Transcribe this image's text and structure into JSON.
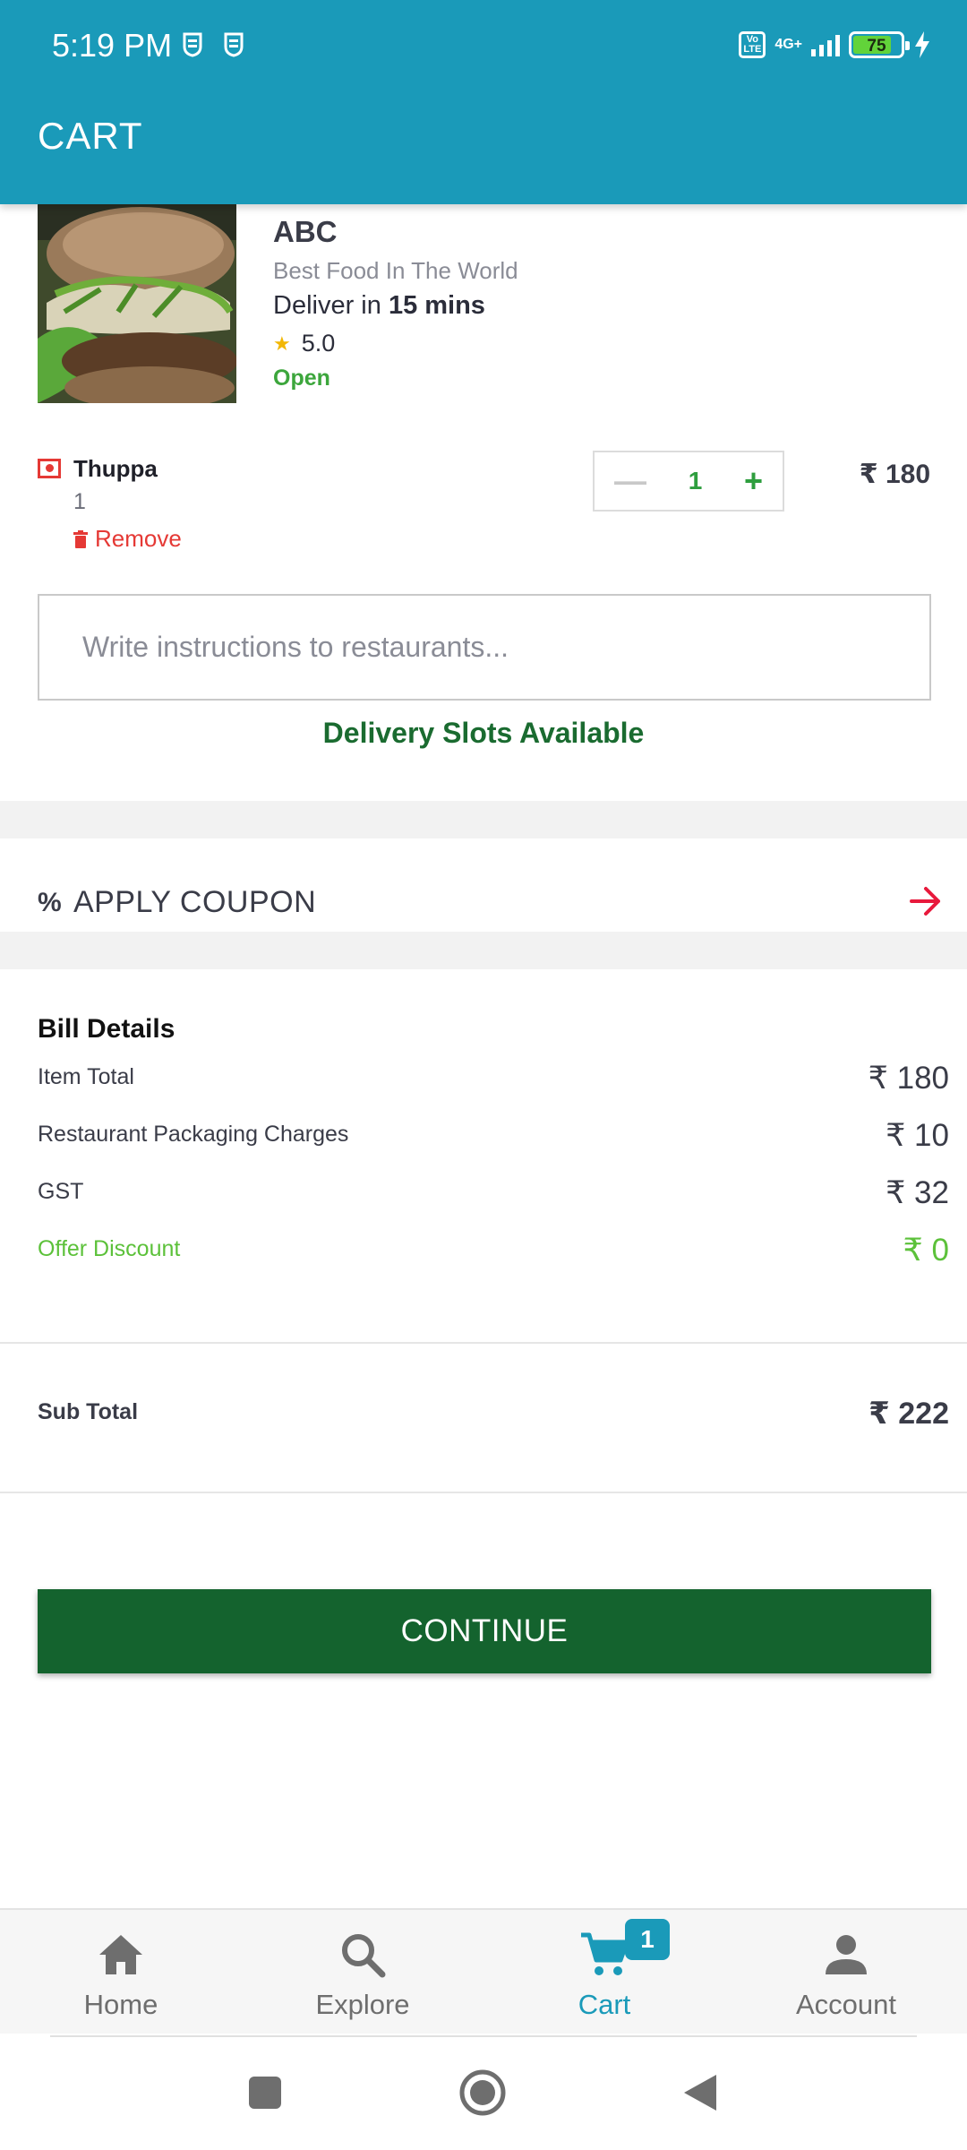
{
  "status_bar": {
    "time": "5:19 PM",
    "volte": "Vo LTE",
    "network": "4G+",
    "battery": "75"
  },
  "app_bar": {
    "title": "CART"
  },
  "restaurant": {
    "name": "ABC",
    "tagline": "Best Food In The World",
    "deliver_prefix": "Deliver in ",
    "deliver_time": "15 mins",
    "rating": "5.0",
    "status": "Open",
    "image": "burger-photo"
  },
  "cart_item": {
    "name": "Thuppa",
    "quantity_text": "1",
    "remove_label": "Remove",
    "quantity": "1",
    "price": "₹ 180"
  },
  "instructions": {
    "placeholder": "Write instructions to restaurants..."
  },
  "delivery_slots": "Delivery Slots Available",
  "coupon": {
    "icon": "%",
    "label": "APPLY COUPON"
  },
  "bill": {
    "title": "Bill Details",
    "rows": [
      {
        "label": "Item Total",
        "value": "₹ 180"
      },
      {
        "label": "Restaurant Packaging Charges",
        "value": "₹ 10"
      },
      {
        "label": "GST",
        "value": "₹ 32"
      },
      {
        "label": "Offer Discount",
        "value": "₹ 0"
      }
    ],
    "subtotal_label": "Sub Total",
    "subtotal_value": "₹ 222"
  },
  "continue_label": "CONTINUE",
  "bottom_nav": {
    "items": [
      {
        "label": "Home",
        "icon": "home-icon"
      },
      {
        "label": "Explore",
        "icon": "search-icon"
      },
      {
        "label": "Cart",
        "icon": "cart-icon",
        "badge": "1",
        "active": true
      },
      {
        "label": "Account",
        "icon": "account-icon"
      }
    ]
  },
  "colors": {
    "primary": "#1a9ab9",
    "continue": "#14632e",
    "slots_text": "#1a6b30",
    "remove": "#e53935",
    "discount": "#5cc13a"
  }
}
